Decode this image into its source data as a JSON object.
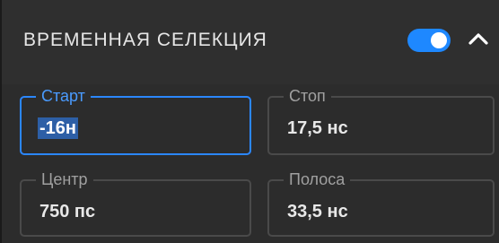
{
  "section": {
    "title": "ВРЕМЕННАЯ СЕЛЕКЦИЯ",
    "toggle_state": "on",
    "accent_color": "#1e88ff",
    "collapse_icon": "chevron-up-icon"
  },
  "fields": {
    "start": {
      "label": "Старт",
      "value": "-16н"
    },
    "stop": {
      "label": "Стоп",
      "value": "17,5 нс"
    },
    "center": {
      "label": "Центр",
      "value": "750 пс"
    },
    "span": {
      "label": "Полоса",
      "value": "33,5 нс"
    }
  }
}
